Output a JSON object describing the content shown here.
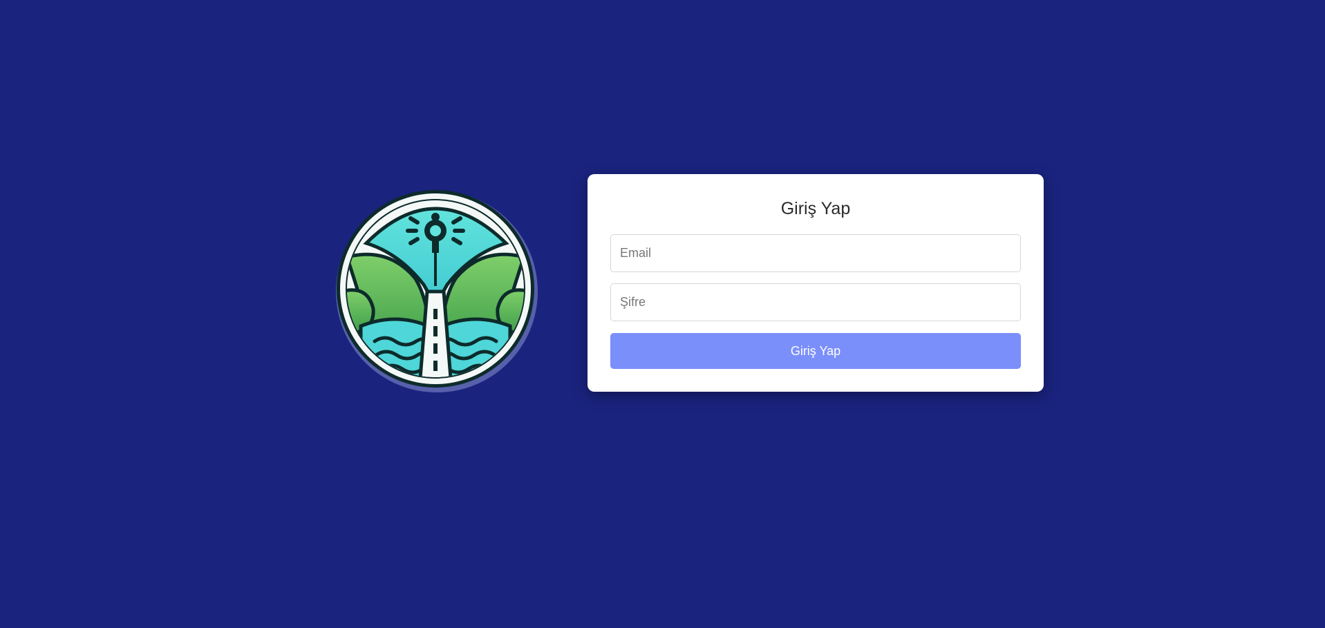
{
  "login": {
    "title": "Giriş Yap",
    "email_placeholder": "Email",
    "password_placeholder": "Şifre",
    "submit_label": "Giriş Yap"
  },
  "logo": {
    "icon": "road-landscape-logo"
  },
  "colors": {
    "background": "#1a237e",
    "card": "#ffffff",
    "button": "#7b8ffb",
    "logo_teal": "#4dd9d6",
    "logo_green": "#5cb85c",
    "logo_dark": "#0d2b2b"
  }
}
